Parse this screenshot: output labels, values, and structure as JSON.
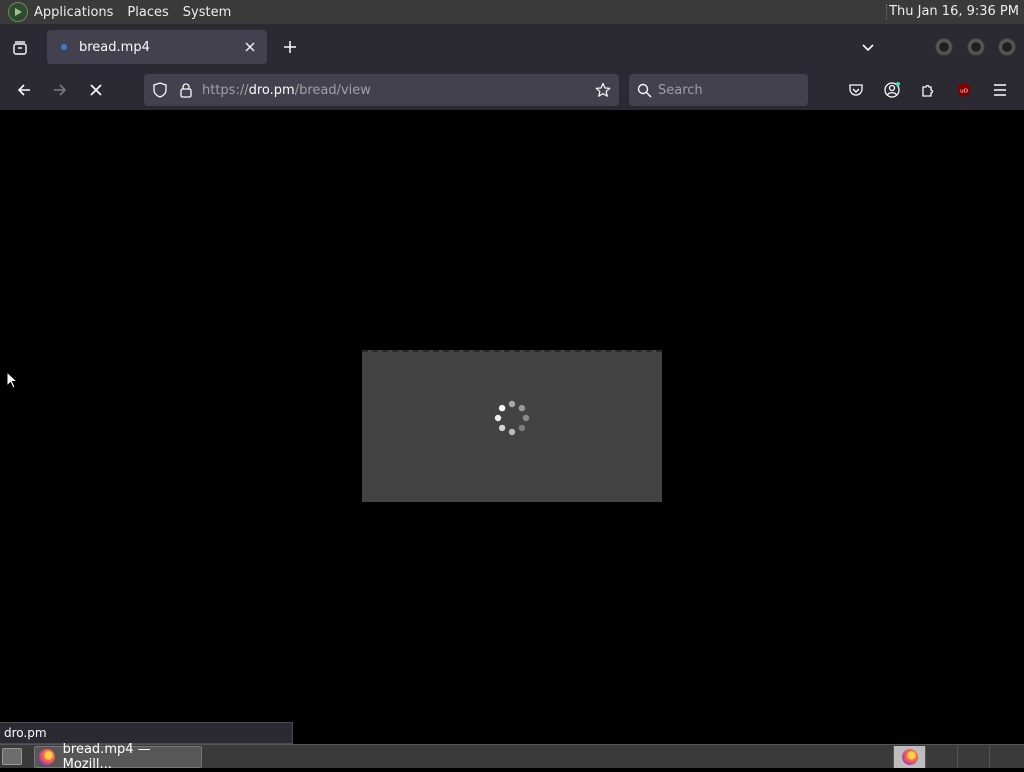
{
  "system_panel": {
    "menus": [
      "Applications",
      "Places",
      "System"
    ],
    "clock": "Thu Jan 16,  9:36 PM"
  },
  "browser": {
    "tab": {
      "title": "bread.mp4"
    },
    "url": {
      "prefix": "https://",
      "domain": "dro.pm",
      "path": "/bread/view"
    },
    "search_placeholder": "Search",
    "status_text": "dro.pm",
    "loading": true
  },
  "taskbar": {
    "window_label": "bread.mp4 — Mozill..."
  },
  "icons": {
    "tab_list": "tab-list-icon",
    "close_tab": "close-icon",
    "new_tab": "plus-icon",
    "list_all_tabs": "chevron-down-icon",
    "back": "arrow-left-icon",
    "forward": "arrow-right-icon",
    "stop": "stop-icon",
    "tracking": "shield-icon",
    "lock": "lock-icon",
    "bookmark": "star-icon",
    "search": "search-icon",
    "pocket": "pocket-icon",
    "account": "account-icon",
    "extensions": "puzzle-icon",
    "ublock": "ublock-icon",
    "menu": "hamburger-icon",
    "video_loading": "spinner-icon"
  },
  "colors": {
    "panel": "#3a3a3a",
    "toolbar": "#2b2a33",
    "field": "#42414d",
    "video_placeholder": "#434343",
    "ublock_red": "#800000"
  }
}
